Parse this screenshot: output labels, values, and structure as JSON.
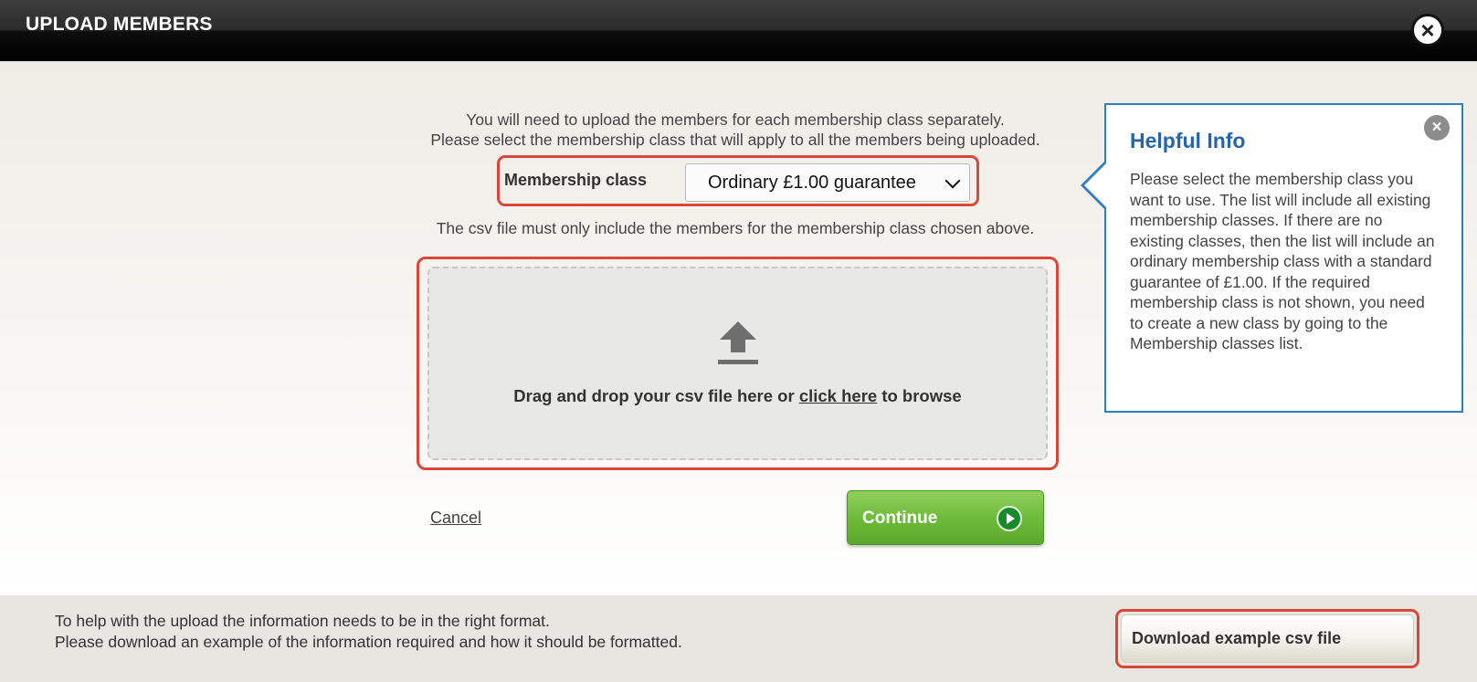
{
  "dialog": {
    "title": "UPLOAD MEMBERS",
    "close_symbol": "×"
  },
  "intro": {
    "line1": "You will need to upload the members for each membership class separately.",
    "line2": "Please select the membership class that will apply to all the members being uploaded."
  },
  "membership": {
    "label": "Membership class",
    "selected": "Ordinary £1.00 guarantee"
  },
  "csv_note": "The csv file must only include the members for the membership class chosen above.",
  "dropzone": {
    "text_before": "Drag and drop your csv file here or",
    "link": "click here",
    "text_after": "to browse",
    "icon": "upload-icon"
  },
  "actions": {
    "cancel": "Cancel",
    "continue": "Continue"
  },
  "helpful_info": {
    "title": "Helpful Info",
    "close_symbol": "×",
    "body": "Please select the membership class you want to use. The list will include all existing membership classes. If there are no existing classes, then the list will include an ordinary membership class with a standard guarantee of £1.00. If the required membership class is not shown, you need to create a new class by going to the Membership classes list."
  },
  "footer": {
    "line1": "To help with the upload the information needs to be in the right format.",
    "line2": "Please download an example of the information required and how it should be formatted.",
    "download_button": "Download example csv file"
  },
  "colors": {
    "highlight_border": "#d9473b",
    "info_accent": "#2d7ec4",
    "continue_green": "#6fbc3c"
  }
}
